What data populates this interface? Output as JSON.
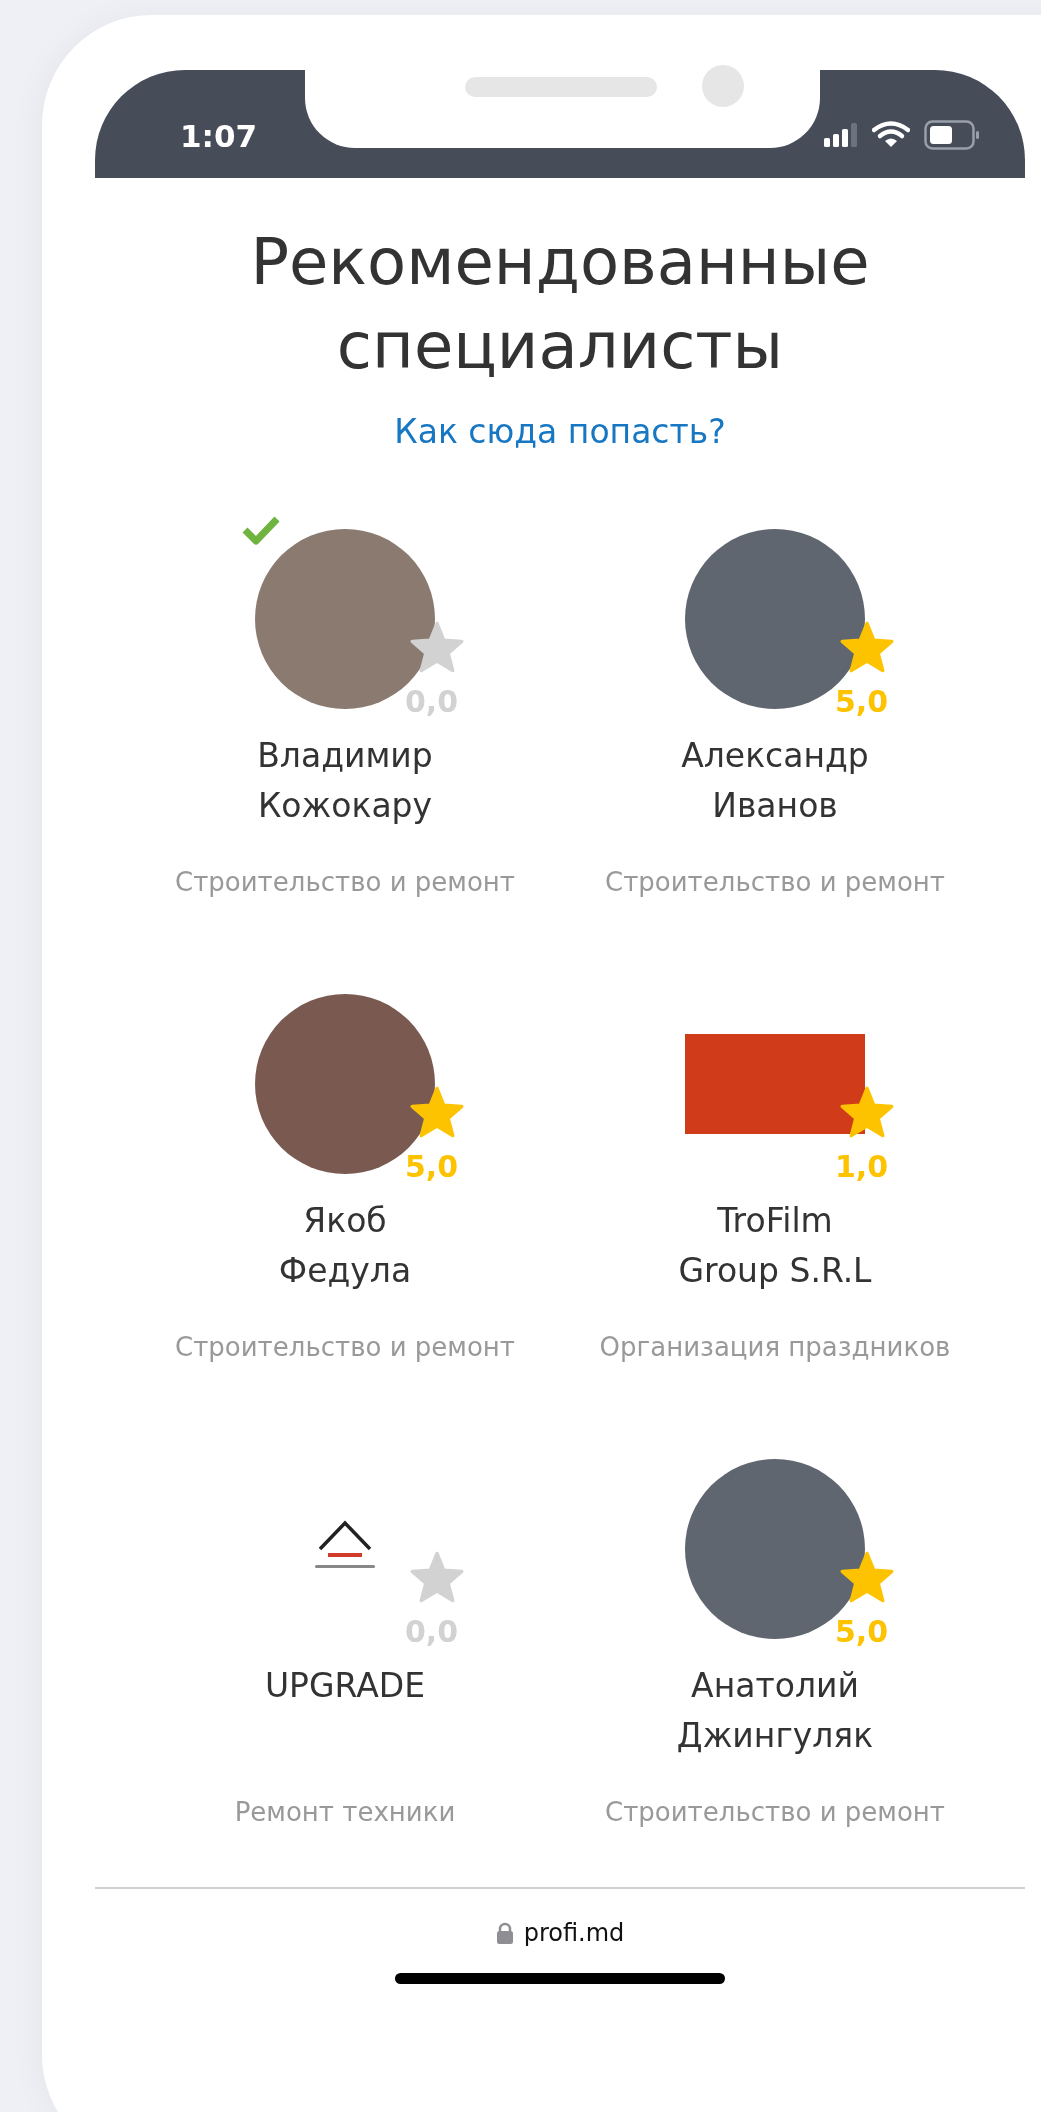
{
  "status_bar": {
    "time": "1:07"
  },
  "title": "Рекомендованные специалисты",
  "help_link": "Как сюда попасть?",
  "specialists": [
    {
      "name": "Владимир Кожокару",
      "category": "Строительство и ремонт",
      "rating": "0,0",
      "star_filled": false,
      "verified": true,
      "kind": "photo"
    },
    {
      "name": "Александр Иванов",
      "category": "Строительство и ремонт",
      "rating": "5,0",
      "star_filled": true,
      "verified": false,
      "kind": "photo"
    },
    {
      "name": "Якоб Федула",
      "category": "Строительство и ремонт",
      "rating": "5,0",
      "star_filled": true,
      "verified": false,
      "kind": "photo"
    },
    {
      "name": "TroFilm Group S.R.L",
      "category": "Организация праздников",
      "rating": "1,0",
      "star_filled": true,
      "verified": false,
      "kind": "banner"
    },
    {
      "name": "UPGRADE",
      "category": "Ремонт техники",
      "rating": "0,0",
      "star_filled": false,
      "verified": false,
      "kind": "wordmark"
    },
    {
      "name": "Анатолий Джингуляк",
      "category": "Строительство и ремонт",
      "rating": "5,0",
      "star_filled": true,
      "verified": false,
      "kind": "photo"
    }
  ],
  "address_bar": {
    "url": "profi.md"
  }
}
